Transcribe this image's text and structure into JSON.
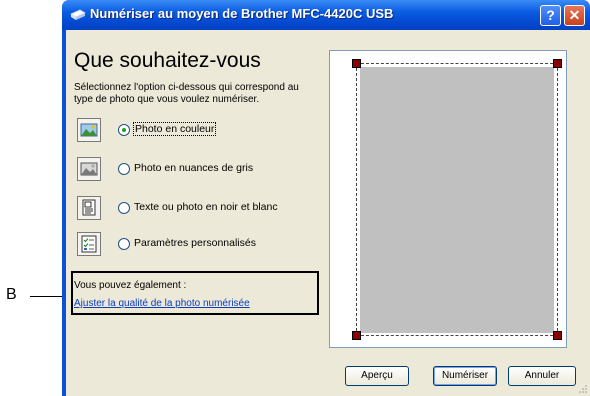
{
  "callout": {
    "letter": "B"
  },
  "window": {
    "title": "Numériser au moyen de Brother MFC-4420C USB",
    "help_label": "?",
    "close_label": "✕"
  },
  "main": {
    "heading": "Que souhaitez-vous",
    "description": "Sélectionnez l'option ci-dessous qui correspond au type de photo que vous voulez numériser.",
    "options": [
      {
        "label": "Photo en couleur",
        "selected": true,
        "icon": "color-photo-icon"
      },
      {
        "label": "Photo en nuances de gris",
        "selected": false,
        "icon": "grayscale-photo-icon"
      },
      {
        "label": "Texte ou photo en noir et blanc",
        "selected": false,
        "icon": "text-bw-icon"
      },
      {
        "label": "Paramètres personnalisés",
        "selected": false,
        "icon": "custom-settings-icon"
      }
    ],
    "also_text": "Vous pouvez également :",
    "also_link": "Ajuster la qualité de la photo numérisée"
  },
  "buttons": {
    "preview": "Aperçu",
    "scan": "Numériser",
    "cancel": "Annuler"
  },
  "colors": {
    "titlebar": "#0a5ce2",
    "client_bg": "#ece9d8",
    "handle": "#8b0000",
    "link": "#0b3cc1"
  }
}
